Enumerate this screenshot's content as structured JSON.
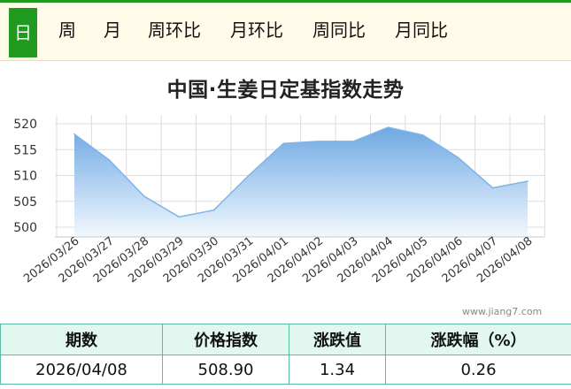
{
  "tabs": [
    {
      "label": "日",
      "active": true
    },
    {
      "label": "周",
      "active": false
    },
    {
      "label": "月",
      "active": false
    },
    {
      "label": "周环比",
      "active": false
    },
    {
      "label": "月环比",
      "active": false
    },
    {
      "label": "周同比",
      "active": false
    },
    {
      "label": "月同比",
      "active": false
    }
  ],
  "chart_data": {
    "type": "area",
    "title": "中国·生姜日定基指数走势",
    "xlabel": "",
    "ylabel": "",
    "x": [
      "2026/03/26",
      "2026/03/27",
      "2026/03/28",
      "2026/03/29",
      "2026/03/30",
      "2026/03/31",
      "2026/04/01",
      "2026/04/02",
      "2026/04/03",
      "2026/04/04",
      "2026/04/05",
      "2026/04/06",
      "2026/04/07",
      "2026/04/08"
    ],
    "values": [
      518.0,
      513.0,
      506.0,
      502.0,
      503.3,
      510.0,
      516.2,
      516.6,
      516.6,
      519.3,
      517.8,
      513.5,
      507.6,
      508.9
    ],
    "ylim": [
      500,
      520
    ],
    "yticks": [
      "520",
      "515",
      "510",
      "505",
      "500"
    ],
    "grid": true,
    "colors": {
      "line": "#7fb4e6",
      "fill_top": "#6fa8e3",
      "fill_bottom": "#f2f8fe",
      "grid": "#dcdcdc"
    }
  },
  "watermark": "www.jiang7.com",
  "table": {
    "headers": [
      "期数",
      "价格指数",
      "涨跌值",
      "涨跌幅（%）"
    ],
    "row": [
      "2026/04/08",
      "508.90",
      "1.34",
      "0.26"
    ]
  },
  "colors": {
    "accent": "#1f9a1f",
    "tab_bg": "#fffbe8",
    "table_border": "#5bbba8",
    "table_header_bg": "#e3f7f1"
  }
}
